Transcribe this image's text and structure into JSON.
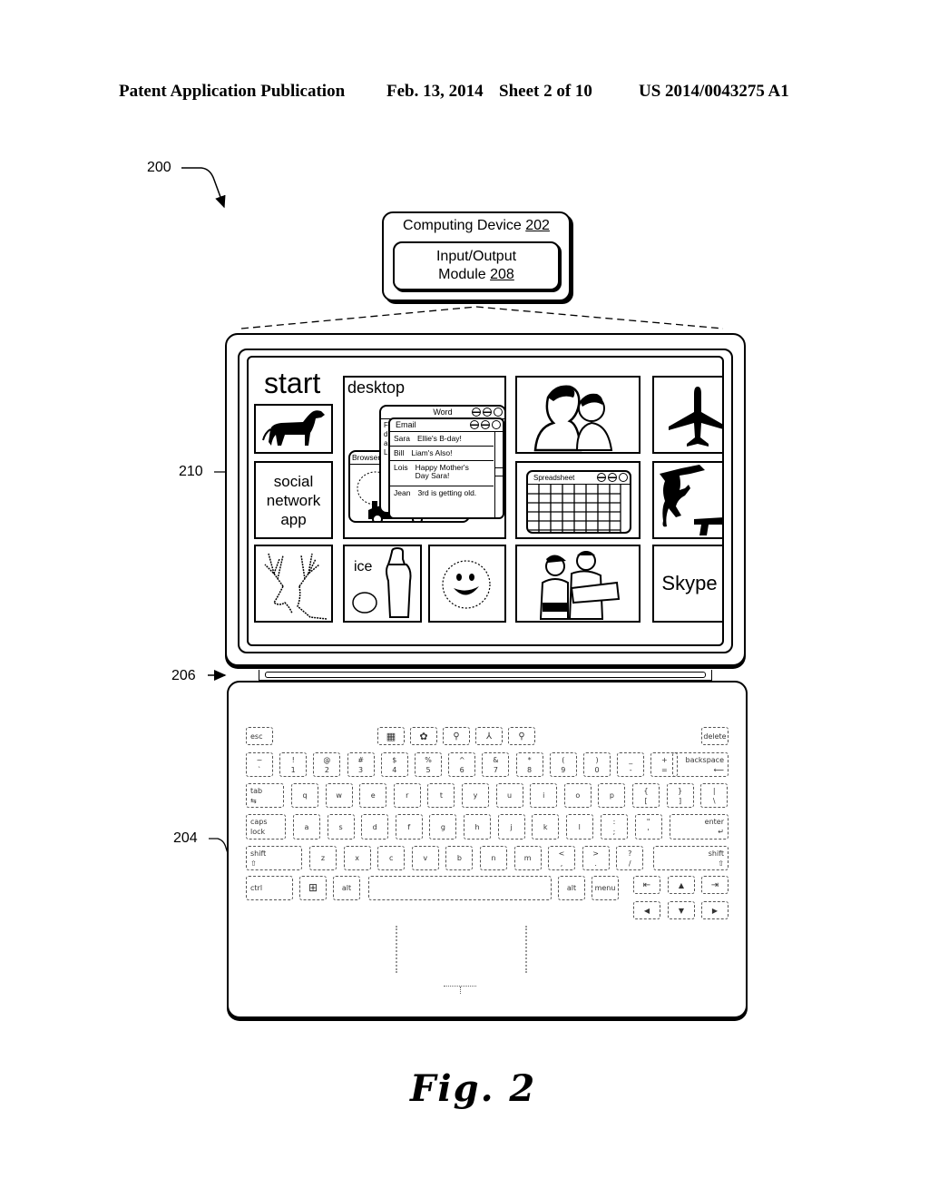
{
  "header": {
    "left": "Patent Application Publication",
    "date": "Feb. 13, 2014",
    "sheet": "Sheet 2 of 10",
    "number": "US 2014/0043275 A1"
  },
  "refs": {
    "system": "200",
    "keyboard": "204",
    "connector": "206",
    "display": "210"
  },
  "device": {
    "title": "Computing Device",
    "title_ref": "202",
    "module_line1": "Input/Output",
    "module_line2": "Module",
    "module_ref": "208"
  },
  "screen": {
    "start_label": "start",
    "tiles": {
      "dog": "dog-icon",
      "social": "social network app",
      "desktop": "desktop",
      "family_photo": "family-photo",
      "airplane": "airplane-icon",
      "spreadsheet": "Spreadsheet",
      "game": "monkey-gun-icon",
      "deer": "deer-icon",
      "ice": "ice",
      "sun": "sun-icon",
      "people": "people-photo",
      "skype": "Skype"
    },
    "desktop_windows": {
      "word_title": "Word",
      "email_title": "Email",
      "browser_title": "Browser",
      "word_side": [
        "F",
        "d",
        "a",
        "L"
      ],
      "emails": [
        {
          "from": "Sara",
          "subject": "Ellie's B-day!"
        },
        {
          "from": "Bill",
          "subject": "Liam's Also!"
        },
        {
          "from": "Lois",
          "subject": "Happy Mother's Day Sara!"
        },
        {
          "from": "Jean",
          "subject": "3rd is getting old."
        }
      ]
    }
  },
  "keyboard": {
    "row0": [
      "esc",
      "delete"
    ],
    "row0_icons": [
      "grid-icon",
      "settings-icon",
      "share-icon",
      "devices-icon",
      "search-icon"
    ],
    "row1": [
      [
        "~",
        "`"
      ],
      [
        "!",
        "1"
      ],
      [
        "@",
        "2"
      ],
      [
        "#",
        "3"
      ],
      [
        "$",
        "4"
      ],
      [
        "%",
        "5"
      ],
      [
        "^",
        "6"
      ],
      [
        "&",
        "7"
      ],
      [
        "*",
        "8"
      ],
      [
        "(",
        "9"
      ],
      [
        ")",
        "0"
      ],
      [
        "_",
        "-"
      ],
      [
        "+",
        "="
      ]
    ],
    "backspace": [
      "backspace",
      "⟵"
    ],
    "tab": [
      "tab",
      "⇆"
    ],
    "row2": [
      "q",
      "w",
      "e",
      "r",
      "t",
      "y",
      "u",
      "i",
      "o",
      "p"
    ],
    "row2_sym": [
      [
        "{",
        "["
      ],
      [
        "}",
        "]"
      ],
      [
        "|",
        "\\"
      ]
    ],
    "caps": [
      "caps",
      "lock"
    ],
    "row3": [
      "a",
      "s",
      "d",
      "f",
      "g",
      "h",
      "j",
      "k",
      "l"
    ],
    "row3_sym": [
      [
        ":",
        ";"
      ],
      [
        "\"",
        "'"
      ]
    ],
    "enter": [
      "enter",
      "↵"
    ],
    "shift": [
      "shift",
      "⇧"
    ],
    "row4": [
      "z",
      "x",
      "c",
      "v",
      "b",
      "n",
      "m"
    ],
    "row4_sym": [
      [
        "<",
        ","
      ],
      [
        ">",
        "."
      ],
      [
        "?",
        "/"
      ]
    ],
    "row5": {
      "ctrl": "ctrl",
      "win": "⊞",
      "alt": "alt",
      "alt2": "alt",
      "menu": "menu"
    },
    "arrows": {
      "home": "⇤",
      "up": "▲",
      "end": "⇥",
      "left": "◀",
      "down": "▼",
      "right": "▶"
    }
  },
  "caption": "Fig. 2"
}
